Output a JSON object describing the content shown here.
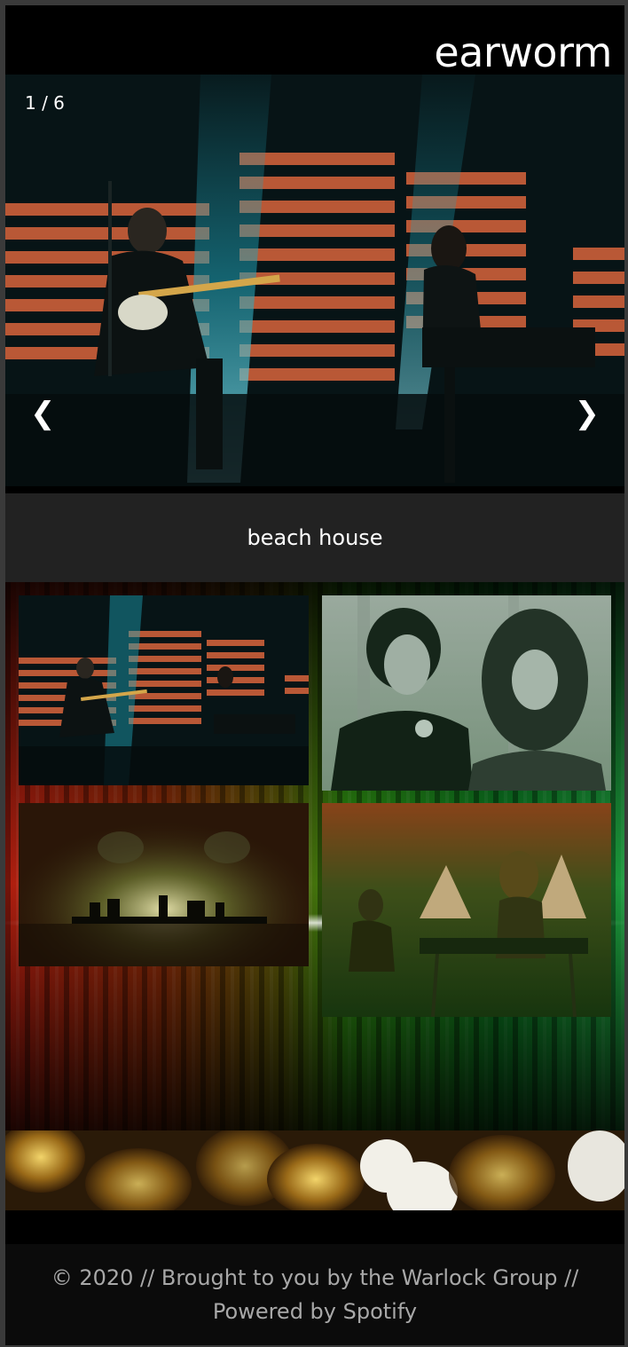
{
  "header": {
    "brand": "earworm"
  },
  "slideshow": {
    "counter": "1 / 6",
    "prev_icon": "chevron-left-icon",
    "next_icon": "chevron-right-icon",
    "prev_glyph": "❮",
    "next_glyph": "❯"
  },
  "caption": {
    "artist": "beach house"
  },
  "gallery": {
    "thumbnails": [
      "concert-stage-photo",
      "duo-portrait-photo",
      "silhouette-stage-photo",
      "keyboard-performance-photo"
    ]
  },
  "footer": {
    "text": "© 2020 // Brought to you by the Warlock Group // Powered by Spotify"
  },
  "colors": {
    "accent_stripe": "#d9643c",
    "stage_blue": "#1fa3b8",
    "caption_bg": "#222222"
  }
}
